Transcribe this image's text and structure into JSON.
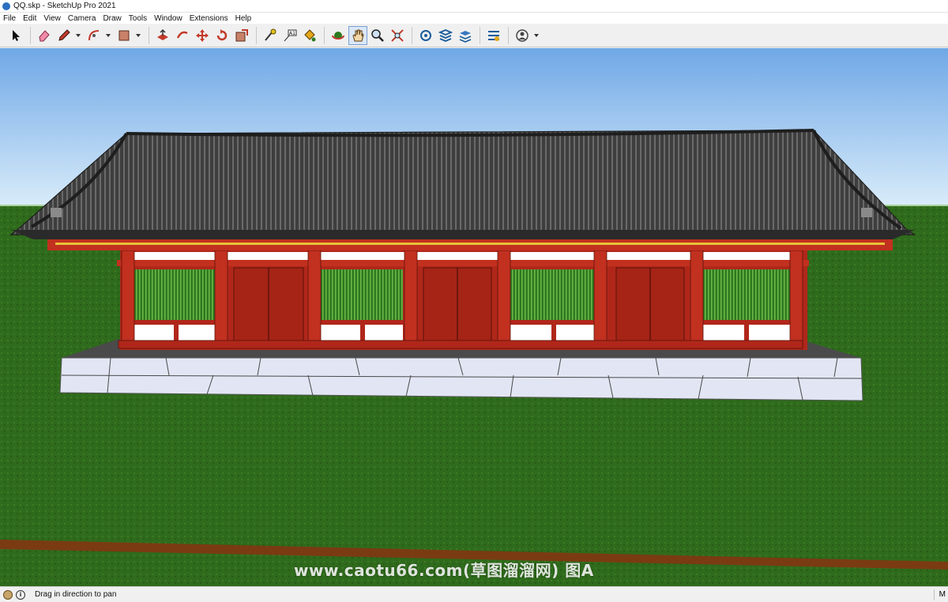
{
  "window": {
    "title": "QQ.skp - SketchUp Pro 2021"
  },
  "menu": [
    "File",
    "Edit",
    "View",
    "Camera",
    "Draw",
    "Tools",
    "Window",
    "Extensions",
    "Help"
  ],
  "toolbar": {
    "tools": [
      {
        "name": "select-tool",
        "icon": "arrow-icon"
      },
      {
        "name": "eraser-tool",
        "icon": "eraser-icon"
      },
      {
        "name": "line-tool",
        "icon": "pencil-icon"
      },
      {
        "name": "arc-tool",
        "icon": "arc-icon"
      },
      {
        "name": "rectangle-tool",
        "icon": "rectangle-icon"
      },
      {
        "name": "push-pull-tool",
        "icon": "push-pull-icon"
      },
      {
        "name": "follow-me-tool",
        "icon": "follow-me-icon"
      },
      {
        "name": "move-tool",
        "icon": "move-icon"
      },
      {
        "name": "rotate-tool",
        "icon": "rotate-icon"
      },
      {
        "name": "scale-tool",
        "icon": "scale-icon"
      },
      {
        "name": "tape-measure-tool",
        "icon": "tape-icon"
      },
      {
        "name": "text-tool",
        "icon": "text-icon"
      },
      {
        "name": "paint-bucket-tool",
        "icon": "paint-icon"
      },
      {
        "name": "orbit-tool",
        "icon": "orbit-icon"
      },
      {
        "name": "pan-tool",
        "icon": "hand-icon",
        "active": true
      },
      {
        "name": "zoom-tool",
        "icon": "zoom-icon"
      },
      {
        "name": "zoom-extents-tool",
        "icon": "zoom-extents-icon"
      },
      {
        "name": "warehouse-tool",
        "icon": "warehouse-icon"
      },
      {
        "name": "extension-warehouse-tool",
        "icon": "extension-icon"
      },
      {
        "name": "layout-tool",
        "icon": "layers-icon"
      },
      {
        "name": "extension-manager-tool",
        "icon": "extension-manager-icon"
      },
      {
        "name": "account-tool",
        "icon": "account-icon"
      }
    ],
    "colors": {
      "accent": "#2b6fc0",
      "active_bg": "#dbe7f6"
    }
  },
  "scene": {
    "colors": {
      "sky_top": "#6fa8e6",
      "sky_bottom": "#d9ecfa",
      "grass": "#2f6b1c",
      "roof": "#3e3e3e",
      "walls": "#b0271a",
      "plaster": "#ffffff",
      "lattice": "#2c7a1f",
      "stone": "#e2e6f4"
    }
  },
  "watermark": "www.caotu66.com(草图溜溜网) 图A",
  "status": {
    "message": "Drag in direction to pan",
    "right_label": "M"
  }
}
